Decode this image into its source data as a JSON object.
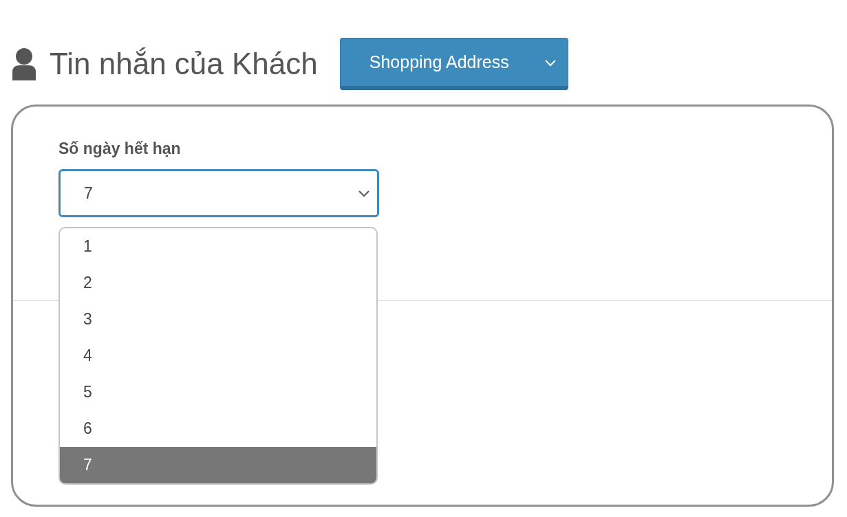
{
  "header": {
    "title": "Tin nhắn của Khách",
    "button": {
      "label": "Shopping Address"
    }
  },
  "expiry": {
    "label": "Số ngày hết hạn",
    "value": "7",
    "expanded": true,
    "options": [
      {
        "label": "1",
        "selected": false
      },
      {
        "label": "2",
        "selected": false
      },
      {
        "label": "3",
        "selected": false
      },
      {
        "label": "4",
        "selected": false
      },
      {
        "label": "5",
        "selected": false
      },
      {
        "label": "6",
        "selected": false
      },
      {
        "label": "7",
        "selected": true
      }
    ]
  }
}
